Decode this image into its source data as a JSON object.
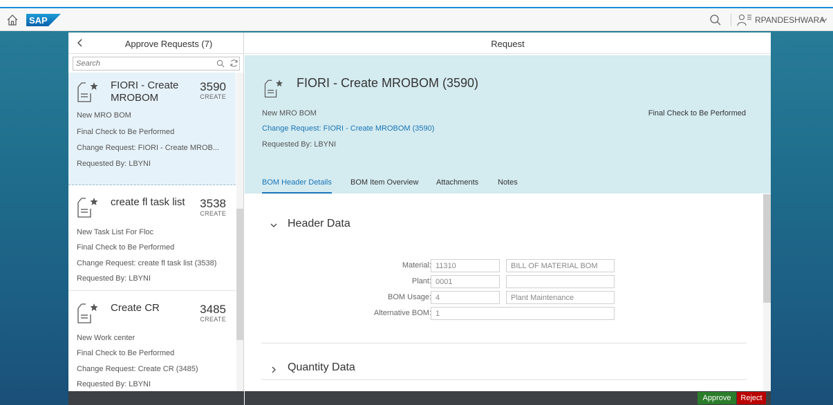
{
  "shell": {
    "logo_text": "SAP",
    "user_name": "RPANDESHWARA"
  },
  "master": {
    "title": "Approve Requests (7)",
    "search_placeholder": "Search",
    "items": [
      {
        "title_line1": "FIORI - Create",
        "title_line2": "MROBOM",
        "number": "3590",
        "status": "CREATE",
        "attr1": "New MRO BOM",
        "attr2": "Final Check to Be Performed",
        "attr3": "Change Request: FIORI - Create MROB...",
        "attr4": "Requested By: LBYNI"
      },
      {
        "title_line1": "create fl task list",
        "title_line2": "",
        "number": "3538",
        "status": "CREATE",
        "attr1": "New Task List For Floc",
        "attr2": "Final Check to Be Performed",
        "attr3": "Change Request: create fl task list (3538)",
        "attr4": "Requested By: LBYNI"
      },
      {
        "title_line1": "Create CR",
        "title_line2": "",
        "number": "3485",
        "status": "CREATE",
        "attr1": "New Work center",
        "attr2": "Final Check to Be Performed",
        "attr3": "Change Request: Create CR (3485)",
        "attr4": "Requested By: LBYNI"
      }
    ]
  },
  "detail": {
    "title": "Request",
    "object_title": "FIORI - Create MROBOM (3590)",
    "attr1": "New MRO BOM",
    "status": "Final Check to Be Performed",
    "link": "Change Request: FIORI - Create MROBOM (3590)",
    "requested_by": "Requested By: LBYNI",
    "tabs": [
      "BOM Header Details",
      "BOM Item Overview",
      "Attachments",
      "Notes"
    ],
    "sections": {
      "header_data": "Header Data",
      "quantity_data": "Quantity Data"
    },
    "fields": [
      {
        "label": "Material:",
        "value": "11310",
        "desc": "BILL OF MATERIAL BOM"
      },
      {
        "label": "Plant:",
        "value": "0001",
        "desc": ""
      },
      {
        "label": "BOM Usage:",
        "value": "4",
        "desc": "Plant Maintenance"
      },
      {
        "label": "Alternative BOM:",
        "value": "1"
      }
    ]
  },
  "footer": {
    "approve": "Approve",
    "reject": "Reject"
  },
  "colors": {
    "accent": "#1a75b6",
    "approve": "#2b7c2b",
    "reject": "#bb0000",
    "header_bg": "#d4ebf0"
  }
}
